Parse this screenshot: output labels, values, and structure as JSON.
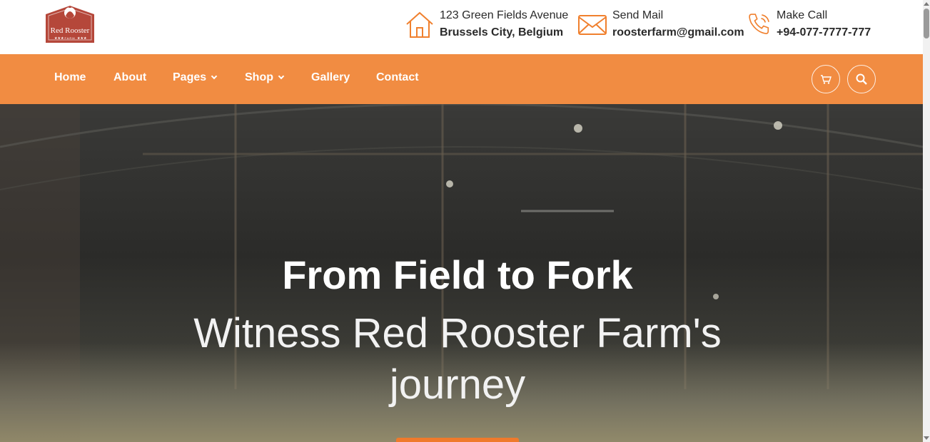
{
  "brand": {
    "logo_name": "Red Rooster",
    "logo_sub": "FARM"
  },
  "contacts": [
    {
      "icon": "house-icon",
      "label": "123 Green Fields Avenue",
      "value": "Brussels City, Belgium"
    },
    {
      "icon": "mail-icon",
      "label": "Send Mail",
      "value": "roosterfarm@gmail.com"
    },
    {
      "icon": "phone-icon",
      "label": "Make Call",
      "value": "+94-077-7777-777"
    }
  ],
  "nav": {
    "items": [
      {
        "label": "Home"
      },
      {
        "label": "About"
      },
      {
        "label": "Pages"
      },
      {
        "label": "Shop"
      },
      {
        "label": "Gallery"
      },
      {
        "label": "Contact"
      }
    ],
    "buttons": [
      "cart-icon",
      "search-icon"
    ]
  },
  "hero": {
    "title": "From Field to Fork",
    "subtitle": "Witness Red Rooster Farm's journey"
  },
  "colors": {
    "accent": "#f0802e",
    "brand_red": "#b5473a"
  }
}
